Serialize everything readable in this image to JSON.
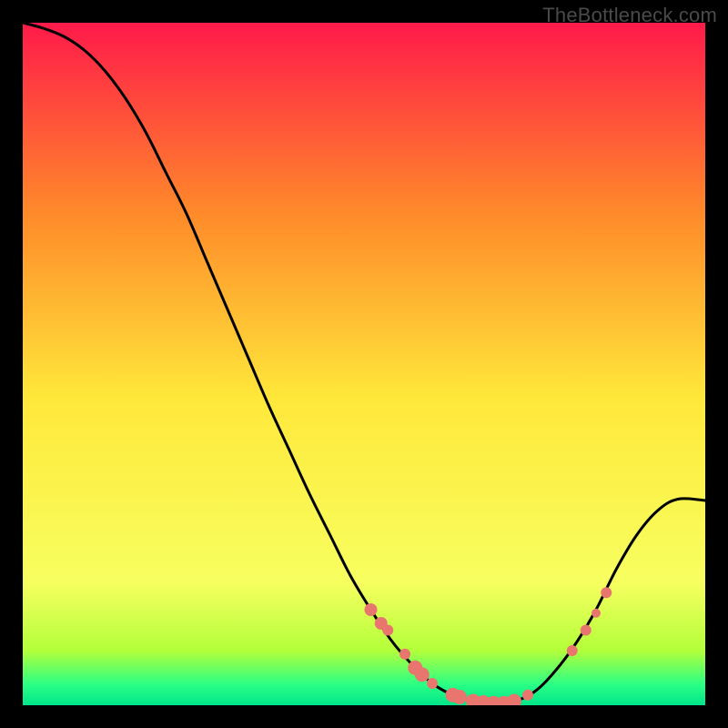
{
  "watermark": "TheBottleneck.com",
  "colors": {
    "gradient_top": "#ff1a4a",
    "gradient_mid_upper": "#ff8a2a",
    "gradient_mid": "#ffe83a",
    "gradient_lower": "#f7ff60",
    "gradient_green1": "#b3ff3a",
    "gradient_green2": "#2aff85",
    "gradient_green3": "#00e58a",
    "curve": "#000000",
    "marker": "#e8766f",
    "frame": "#000000"
  },
  "chart_data": {
    "type": "line",
    "title": "",
    "xlabel": "",
    "ylabel": "",
    "xlim": [
      0,
      100
    ],
    "ylim": [
      0,
      100
    ],
    "series": [
      {
        "name": "bottleneck-curve",
        "x": [
          0,
          3,
          6,
          9,
          12,
          15,
          18,
          21,
          24,
          27,
          30,
          33,
          36,
          39,
          42,
          45,
          48,
          51,
          54,
          57,
          60,
          63,
          66,
          69,
          72,
          75,
          78,
          81,
          84,
          87,
          90,
          93,
          96,
          100
        ],
        "y": [
          100,
          99.2,
          98.0,
          96.0,
          93.0,
          89.0,
          84.0,
          78.0,
          72.0,
          65.0,
          58.0,
          51.0,
          44.0,
          37.5,
          31.0,
          25.0,
          19.0,
          14.0,
          9.5,
          6.0,
          3.2,
          1.5,
          0.6,
          0.3,
          0.6,
          2.0,
          5.0,
          9.0,
          14.0,
          20.0,
          25.0,
          28.5,
          30.2,
          30.0
        ]
      }
    ],
    "markers": [
      {
        "x": 51.0,
        "y": 14.0,
        "size": 7
      },
      {
        "x": 52.5,
        "y": 12.0,
        "size": 7
      },
      {
        "x": 53.5,
        "y": 11.0,
        "size": 6
      },
      {
        "x": 56.0,
        "y": 7.5,
        "size": 6
      },
      {
        "x": 57.5,
        "y": 5.5,
        "size": 8
      },
      {
        "x": 58.5,
        "y": 4.5,
        "size": 8
      },
      {
        "x": 60.0,
        "y": 3.2,
        "size": 6
      },
      {
        "x": 63.0,
        "y": 1.5,
        "size": 8
      },
      {
        "x": 64.0,
        "y": 1.2,
        "size": 8
      },
      {
        "x": 66.0,
        "y": 0.6,
        "size": 8
      },
      {
        "x": 67.5,
        "y": 0.4,
        "size": 8
      },
      {
        "x": 69.0,
        "y": 0.3,
        "size": 8
      },
      {
        "x": 70.5,
        "y": 0.3,
        "size": 8
      },
      {
        "x": 72.0,
        "y": 0.6,
        "size": 8
      },
      {
        "x": 74.0,
        "y": 1.5,
        "size": 6
      },
      {
        "x": 80.5,
        "y": 8.0,
        "size": 6
      },
      {
        "x": 82.5,
        "y": 11.0,
        "size": 6
      },
      {
        "x": 84.0,
        "y": 13.5,
        "size": 5
      },
      {
        "x": 85.5,
        "y": 16.5,
        "size": 6
      }
    ]
  }
}
